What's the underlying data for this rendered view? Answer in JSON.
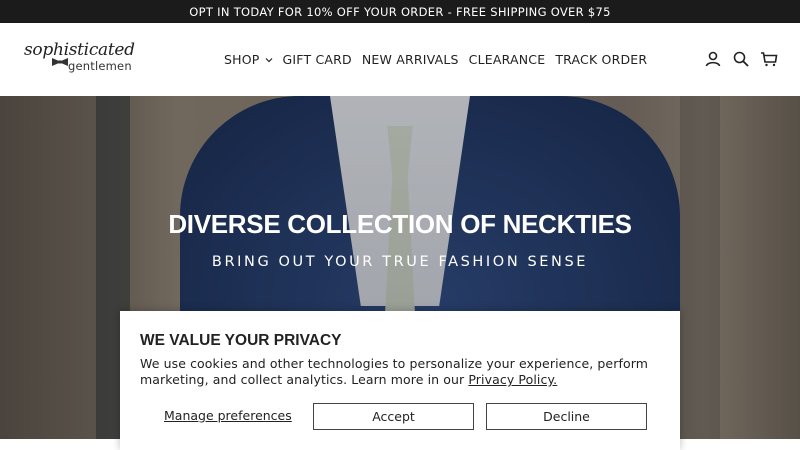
{
  "announcement": "OPT IN TODAY FOR 10% OFF YOUR ORDER - FREE SHIPPING OVER $75",
  "logo": {
    "line1": "sophisticated",
    "line2": "gentlemen"
  },
  "nav": {
    "items": [
      {
        "label": "SHOP",
        "has_dropdown": true
      },
      {
        "label": "GIFT CARD"
      },
      {
        "label": "NEW ARRIVALS"
      },
      {
        "label": "CLEARANCE"
      },
      {
        "label": "TRACK ORDER"
      }
    ]
  },
  "header_icons": [
    "account-icon",
    "search-icon",
    "cart-icon"
  ],
  "hero": {
    "title": "DIVERSE COLLECTION OF NECKTIES",
    "subtitle": "BRING OUT YOUR TRUE FASHION SENSE"
  },
  "cookie_banner": {
    "title": "WE VALUE YOUR PRIVACY",
    "body": "We use cookies and other technologies to personalize your experience, perform marketing, and collect analytics. Learn more in our",
    "link": "Privacy Policy.",
    "manage_label": "Manage preferences",
    "accept_label": "Accept",
    "decline_label": "Decline"
  },
  "colors": {
    "announcement_bg": "#1b1b1b",
    "text": "#222222",
    "suit_blue": "#2f4a7e"
  }
}
